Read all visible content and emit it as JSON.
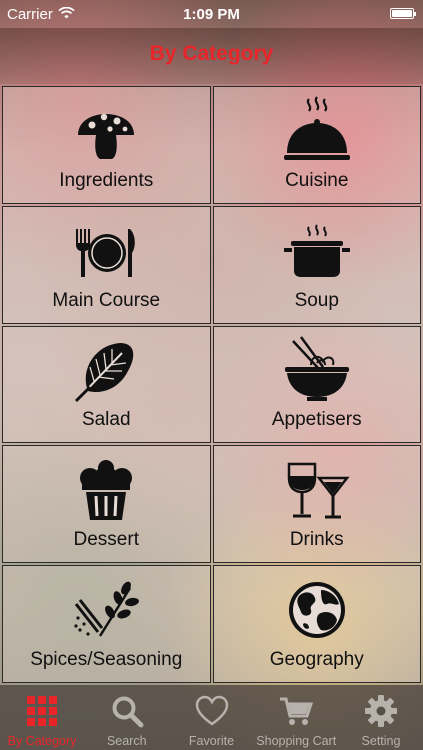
{
  "status_bar": {
    "carrier": "Carrier",
    "time": "1:09 PM"
  },
  "nav": {
    "title": "By Category"
  },
  "categories": [
    {
      "label": "Ingredients",
      "icon": "mushroom-icon"
    },
    {
      "label": "Cuisine",
      "icon": "cloche-icon"
    },
    {
      "label": "Main Course",
      "icon": "plate-cutlery-icon"
    },
    {
      "label": "Soup",
      "icon": "soup-pot-icon"
    },
    {
      "label": "Salad",
      "icon": "leaf-icon"
    },
    {
      "label": "Appetisers",
      "icon": "noodle-bowl-icon"
    },
    {
      "label": "Dessert",
      "icon": "cupcake-icon"
    },
    {
      "label": "Drinks",
      "icon": "wine-glasses-icon"
    },
    {
      "label": "Spices/Seasoning",
      "icon": "herbs-icon"
    },
    {
      "label": "Geography",
      "icon": "globe-icon"
    }
  ],
  "tabs": [
    {
      "label": "By Category",
      "icon": "grid-icon",
      "active": true
    },
    {
      "label": "Search",
      "icon": "search-icon",
      "active": false
    },
    {
      "label": "Favorite",
      "icon": "heart-icon",
      "active": false
    },
    {
      "label": "Shopping Cart",
      "icon": "cart-icon",
      "active": false
    },
    {
      "label": "Setting",
      "icon": "gear-icon",
      "active": false
    }
  ],
  "colors": {
    "accent": "#e8262a",
    "tab_inactive": "#b8b2ad",
    "icon": "#111111"
  }
}
